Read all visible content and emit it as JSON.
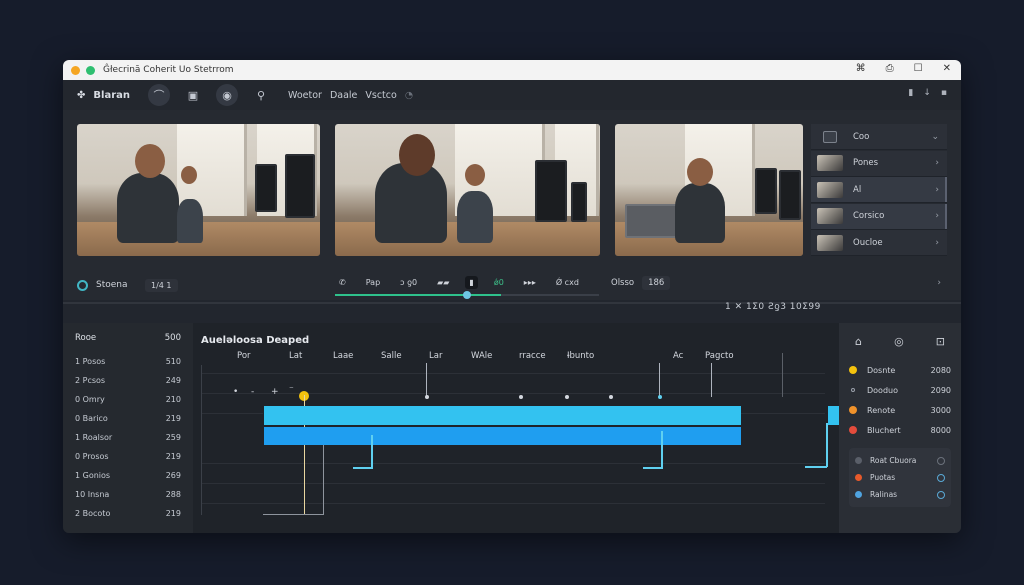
{
  "titlebar": {
    "title": "Ĝłecrinā Coherit Uo Stetrrom",
    "controls": [
      "⌘",
      "⎙",
      "☐",
      "✕"
    ],
    "traffic": [
      "#f5a623",
      "#2fbf71"
    ]
  },
  "toolbar": {
    "brand": "Blaran",
    "menus": [
      "Woetor",
      "Daale",
      "Vsctco"
    ],
    "right_items": [
      "▮",
      "↓",
      "▪"
    ]
  },
  "scenes": [
    {
      "label": "Coo",
      "type": "folder"
    },
    {
      "label": "Pones",
      "type": "clip"
    },
    {
      "label": "Al",
      "type": "clip",
      "active": true
    },
    {
      "label": "Corsico",
      "type": "clip",
      "active": true
    },
    {
      "label": "Oucloe",
      "type": "clip"
    }
  ],
  "transport": {
    "scene_name": "Stoena",
    "counter": "1/4 1",
    "controls": [
      "Pap",
      "ᴐ ƍ0",
      "▰▰",
      "▮",
      "ǿ0",
      "▸▸▸",
      "Ǿ cxd"
    ],
    "zoom_label": "Olsso",
    "zoom_value": "186",
    "progress": 0.63,
    "progress_knob": 0.5,
    "timecode": "1 ✕ 1Ʃ0  Ƨƍ3  10Ʃ99"
  },
  "tracks": {
    "header": [
      "Rooe",
      "500"
    ],
    "rows": [
      [
        "1 Posos",
        "510"
      ],
      [
        "2 Pcsos",
        "249"
      ],
      [
        "0 Omry",
        "210"
      ],
      [
        "0 Barico",
        "219"
      ],
      [
        "1 Roalsor",
        "259"
      ],
      [
        "0 Prosos",
        "219"
      ],
      [
        "1 Gonios",
        "269"
      ],
      [
        "10 Insna",
        "288"
      ],
      [
        "2 Bocoto",
        "219"
      ]
    ]
  },
  "timeline": {
    "title": "Aueləloosa Deaped",
    "ruler": [
      "Por",
      "Lat",
      "Laae",
      "Salle",
      "Lar",
      "WAle",
      "rracce",
      "Ɨbunto",
      "Ac",
      "Pagcto"
    ],
    "markers": [
      "•",
      "-",
      "+",
      "⁻"
    ]
  },
  "properties": {
    "icons": [
      "⌂",
      "◎",
      "⊡"
    ],
    "rows": [
      {
        "label": "Dosnte",
        "value": "2080",
        "color": "#f4c20d"
      },
      {
        "label": "Dooduo",
        "value": "2090",
        "color": "#2a2e35"
      },
      {
        "label": "Renote",
        "value": "3000",
        "color": "#f0922b"
      },
      {
        "label": "Bluchert",
        "value": "8000",
        "color": "#e34c3c"
      }
    ],
    "sub_title": "Roat Cbuora",
    "sub_rows": [
      {
        "label": "Puotas",
        "color": "#e85a2b"
      },
      {
        "label": "Ralinas",
        "color": "#4fa3e0"
      }
    ]
  }
}
